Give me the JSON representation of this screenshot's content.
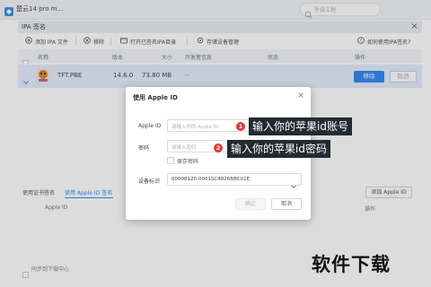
{
  "app": {
    "title": "楚云14 pro m...",
    "search_placeholder": "外设工程"
  },
  "window": {
    "title": "IPA 签名",
    "close_glyph": "×"
  },
  "toolbar": {
    "add_ipa": "添加 IPA 文件",
    "remove": "移除",
    "open_folder": "打开已签名IPA目录",
    "device_management": "存储设备管理",
    "help": "如何使用IPA签名?"
  },
  "table": {
    "columns": [
      "名称",
      "版本",
      "大小",
      "开发者信息",
      "状态",
      "操作"
    ],
    "rows": [
      {
        "name": "TFT.PBE",
        "version": "14.6.0",
        "size": "73.80 MB",
        "developer": "--",
        "status": "",
        "remove_label": "移除",
        "cancel_label": "取消"
      }
    ]
  },
  "lower_panel": {
    "tabs": [
      "使用证书签名",
      "使用 Apple ID 签名"
    ],
    "add_button": "添加 Apple ID",
    "col_apple_id": "Apple ID",
    "col_action": "操作",
    "footer": "同步到下载中心"
  },
  "dialog": {
    "title": "使用 Apple ID",
    "close_glyph": "×",
    "apple_id_label": "Apple ID",
    "apple_id_placeholder": "请输入你的 Apple ID",
    "password_label": "密码",
    "password_placeholder": "请输入密码",
    "save_password_label": "保存密码",
    "device_label": "设备标识",
    "device_value": "00008120-0001SC4826BBC01E",
    "confirm_label": "确定",
    "cancel_label": "取消"
  },
  "annotations": [
    {
      "badge": "1",
      "text": "输入你的苹果id账号"
    },
    {
      "badge": "2",
      "text": "输入你的苹果id密码"
    }
  ],
  "watermark": "软件下载",
  "colors": {
    "accent": "#2f87f4",
    "badge_red": "#e8363b",
    "annotation_bg": "#242a30",
    "selected_row": "#e3eefc"
  }
}
